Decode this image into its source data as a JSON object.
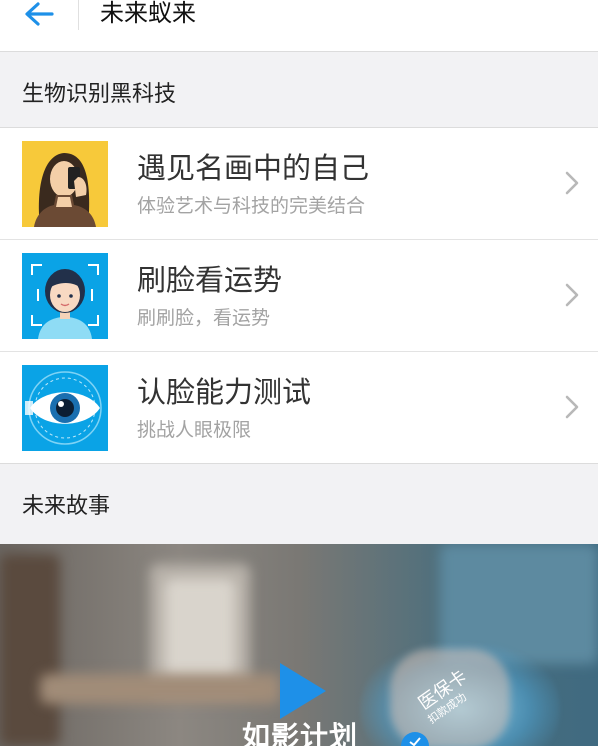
{
  "header": {
    "title": "未来蚁来"
  },
  "sections": {
    "biometrics": "生物识别黑科技",
    "stories": "未来故事"
  },
  "items": [
    {
      "title": "遇见名画中的自己",
      "subtitle": "体验艺术与科技的完美结合",
      "icon": "portrait-painting-icon"
    },
    {
      "title": "刷脸看运势",
      "subtitle": "刷刷脸，看运势",
      "icon": "face-scan-icon"
    },
    {
      "title": "认脸能力测试",
      "subtitle": "挑战人眼极限",
      "icon": "eye-icon"
    }
  ],
  "video": {
    "title": "如影计划",
    "card_title": "医保卡",
    "card_subtitle": "扣款成功"
  },
  "colors": {
    "accent": "#1e90e8",
    "icon_bg_blue": "#0aa3e6",
    "icon_bg_yellow": "#f7c93a"
  }
}
